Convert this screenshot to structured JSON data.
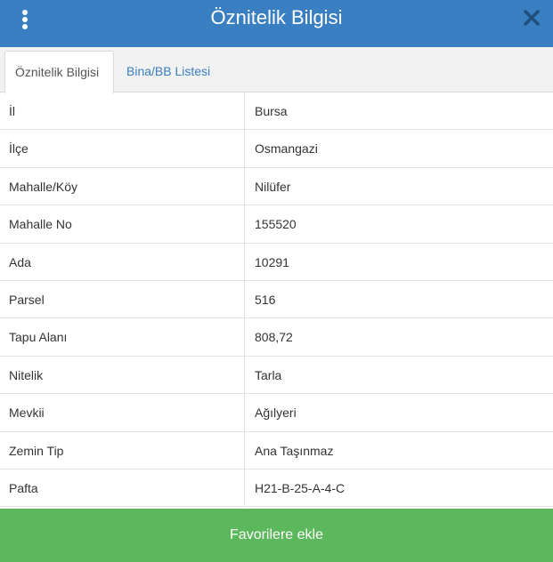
{
  "header": {
    "title": "Öznitelik Bilgisi",
    "menu_icon": "vertical-dots-icon",
    "close_icon": "close-icon",
    "color": "#3a7fc1"
  },
  "tabs": [
    {
      "label": "Öznitelik Bilgisi",
      "active": true
    },
    {
      "label": "Bina/BB Listesi",
      "active": false
    }
  ],
  "attributes": [
    {
      "key": "İl",
      "value": "Bursa"
    },
    {
      "key": "İlçe",
      "value": "Osmangazi"
    },
    {
      "key": "Mahalle/Köy",
      "value": "Nilüfer"
    },
    {
      "key": "Mahalle No",
      "value": "155520"
    },
    {
      "key": "Ada",
      "value": "10291"
    },
    {
      "key": "Parsel",
      "value": "516"
    },
    {
      "key": "Tapu Alanı",
      "value": "808,72"
    },
    {
      "key": "Nitelik",
      "value": "Tarla"
    },
    {
      "key": "Mevkii",
      "value": "Ağılyeri"
    },
    {
      "key": "Zemin Tip",
      "value": "Ana Taşınmaz"
    },
    {
      "key": "Pafta",
      "value": "H21-B-25-A-4-C"
    }
  ],
  "footer": {
    "favorite_label": "Favorilere ekle",
    "color": "#5cb85c"
  }
}
